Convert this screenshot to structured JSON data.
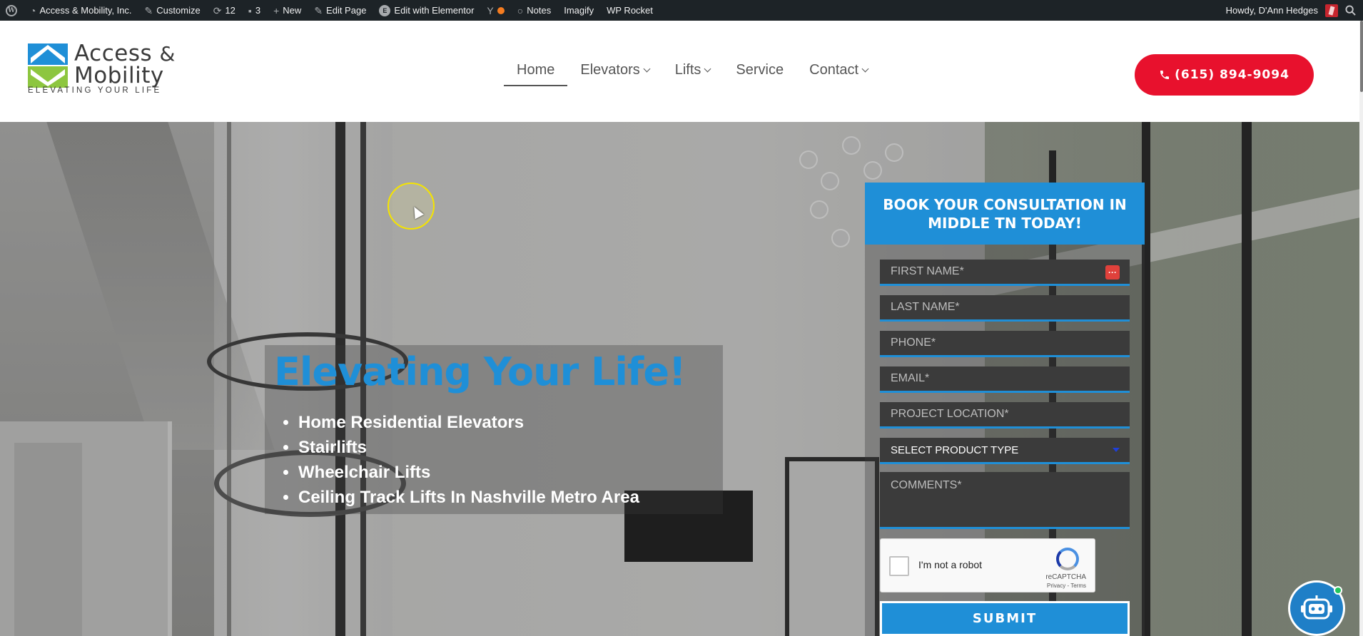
{
  "admin_bar": {
    "site_name": "Access & Mobility, Inc.",
    "customize": "Customize",
    "updates_count": "12",
    "comments_count": "3",
    "new": "New",
    "edit_page": "Edit Page",
    "edit_elementor": "Edit with Elementor",
    "notes": "Notes",
    "imagify": "Imagify",
    "wp_rocket": "WP Rocket",
    "howdy": "Howdy, D'Ann Hedges"
  },
  "logo": {
    "line1": "Access",
    "amp": "&",
    "line2": "Mobility",
    "tagline": "ELEVATING YOUR LIFE"
  },
  "nav": {
    "items": [
      {
        "label": "Home",
        "active": true,
        "dropdown": false
      },
      {
        "label": "Elevators",
        "active": false,
        "dropdown": true
      },
      {
        "label": "Lifts",
        "active": false,
        "dropdown": true
      },
      {
        "label": "Service",
        "active": false,
        "dropdown": false
      },
      {
        "label": "Contact",
        "active": false,
        "dropdown": true
      }
    ]
  },
  "phone_button": {
    "label": "(615) 894-9094"
  },
  "hero": {
    "headline": "Elevating Your Life!",
    "bullets": [
      "Home Residential Elevators",
      "Stairlifts",
      "Wheelchair Lifts",
      "Ceiling Track Lifts In Nashville Metro Area"
    ]
  },
  "form": {
    "title": "BOOK YOUR CONSULTATION IN MIDDLE TN TODAY!",
    "first_name": "FIRST NAME*",
    "last_name": "LAST NAME*",
    "phone": "PHONE*",
    "email": "EMAIL*",
    "project_location": "PROJECT LOCATION*",
    "product_type": "SELECT PRODUCT TYPE",
    "comments": "COMMENTS*",
    "captcha_label": "I'm not a robot",
    "captcha_brand": "reCAPTCHA",
    "captcha_links": "Privacy - Terms",
    "submit": "SUBMIT"
  },
  "colors": {
    "brand_blue": "#1f8fd7",
    "cta_red": "#e8112d",
    "admin_bar": "#1d2327"
  }
}
